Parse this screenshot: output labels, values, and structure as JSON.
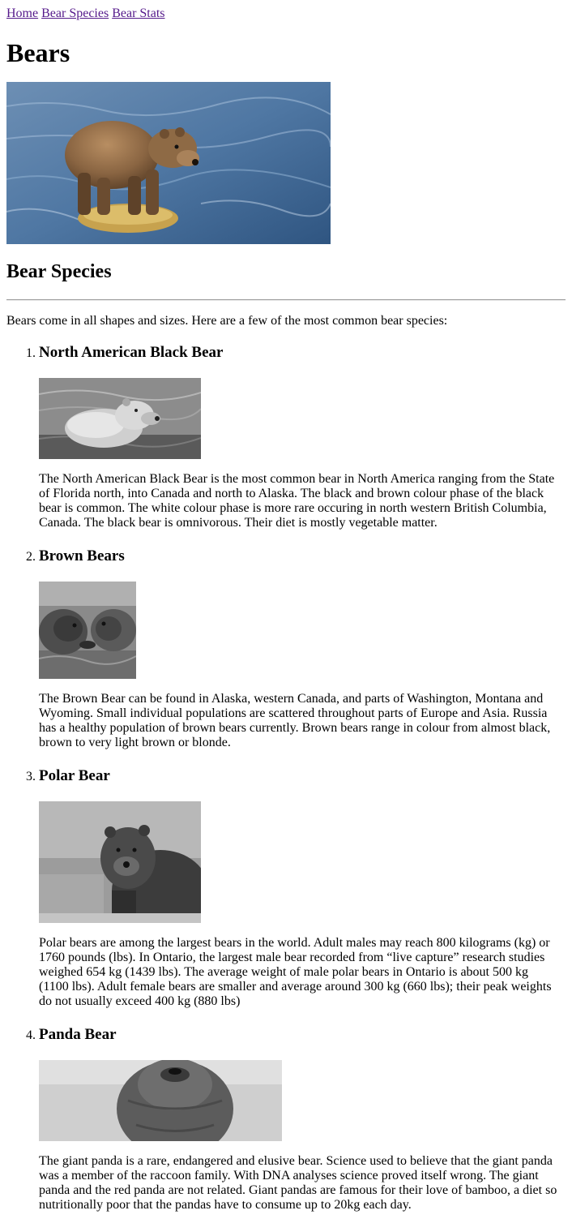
{
  "nav": {
    "links": [
      "Home",
      "Bear Species",
      "Bear Stats"
    ]
  },
  "page_title": "Bears",
  "section_title": "Bear Species",
  "intro": "Bears come in all shapes and sizes. Here are a few of the most common bear species:",
  "species": [
    {
      "name": "North American Black Bear",
      "description": "The North American Black Bear is the most common bear in North America ranging from the State of Florida north, into Canada and north to Alaska. The black and brown colour phase of the black bear is common. The white colour phase is more rare occuring in north western British Columbia, Canada. The black bear is omnivorous. Their diet is mostly vegetable matter."
    },
    {
      "name": "Brown Bears",
      "description": "The Brown Bear can be found in Alaska, western Canada, and parts of Washington, Montana and Wyoming. Small individual populations are scattered throughout parts of Europe and Asia. Russia has a healthy population of brown bears currently. Brown bears range in colour from almost black, brown to very light brown or blonde."
    },
    {
      "name": "Polar Bear",
      "description": "Polar bears are among the largest bears in the world. Adult males may reach 800 kilograms (kg) or 1760 pounds (lbs). In Ontario, the largest male bear recorded from “live capture” research studies weighed 654 kg (1439 lbs). The average weight of male polar bears in Ontario is about 500 kg (1100 lbs). Adult female bears are smaller and average around 300 kg (660 lbs); their peak weights do not usually exceed 400 kg (880 lbs)"
    },
    {
      "name": "Panda Bear",
      "description": "The giant panda is a rare, endangered and elusive bear. Science used to believe that the giant panda was a member of the raccoon family. With DNA analyses science proved itself wrong. The giant panda and the red panda are not related. Giant pandas are famous for their love of bamboo, a diet so nutritionally poor that the pandas have to consume up to 20kg each day."
    }
  ],
  "colors": {
    "link": "#551a8b",
    "text": "#000000",
    "background": "#ffffff"
  }
}
